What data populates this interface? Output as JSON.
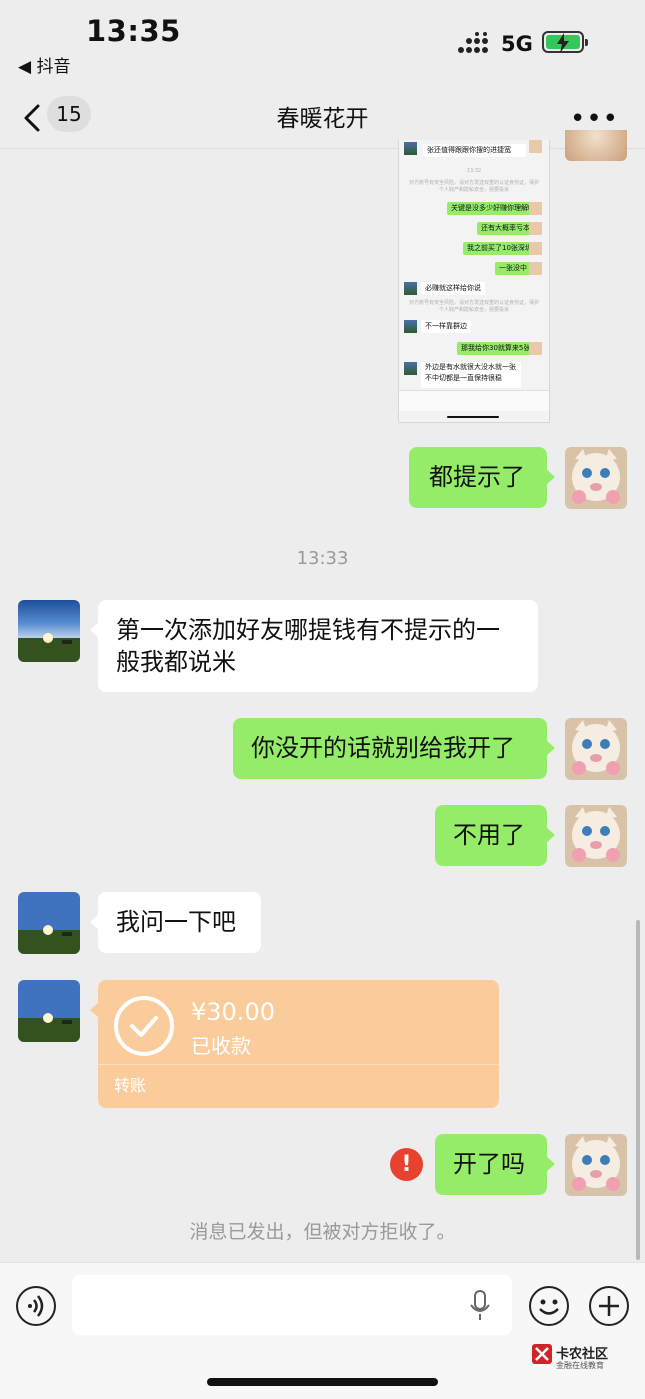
{
  "status_bar": {
    "time": "13:35",
    "back_app": "◀ 抖音",
    "network": "5G",
    "colors": {
      "battery": "#34c759"
    }
  },
  "nav": {
    "unread_count": "15",
    "title": "春暖花开",
    "more_label": "•••"
  },
  "screenshot_image": {
    "timestamp": "13:32",
    "rows": [
      "张还值得跟跟你搜的进捷宽",
      "关键是没多少好赚你理解吗",
      "还有大概率亏本",
      "我之前买了10张深圳",
      "一张没中",
      "必赚就这样给你说",
      "不一样靠群边",
      "那我给你30就算来5张",
      "外边是有水就很大没水就一张不中切都是一直保持很稳"
    ],
    "sys_line": "对方账号有安全风险，请对方发送双重的认证身份证，保护个人财产和隐私安全，我要投诉"
  },
  "messages": [
    {
      "id": "m1",
      "side": "me",
      "text": "都提示了"
    },
    {
      "id": "ts1",
      "type": "timestamp",
      "text": "13:33"
    },
    {
      "id": "m2",
      "side": "other",
      "text": "第一次添加好友哪提钱有不提示的一般我都说米"
    },
    {
      "id": "m3",
      "side": "me",
      "text": "你没开的话就别给我开了"
    },
    {
      "id": "m4",
      "side": "me",
      "text": "不用了"
    },
    {
      "id": "m5",
      "side": "other",
      "text": "我问一下吧"
    },
    {
      "id": "m7",
      "side": "me",
      "text": "开了吗",
      "error_mark": "!"
    }
  ],
  "transfer": {
    "amount": "¥30.00",
    "status": "已收款",
    "label": "转账",
    "color": "#fbcc9b"
  },
  "system_message": "消息已发出，但被对方拒收了。",
  "input_bar": {
    "text_value": ""
  },
  "watermark": {
    "name": "卡农社区",
    "tagline": "金融在线教育"
  }
}
